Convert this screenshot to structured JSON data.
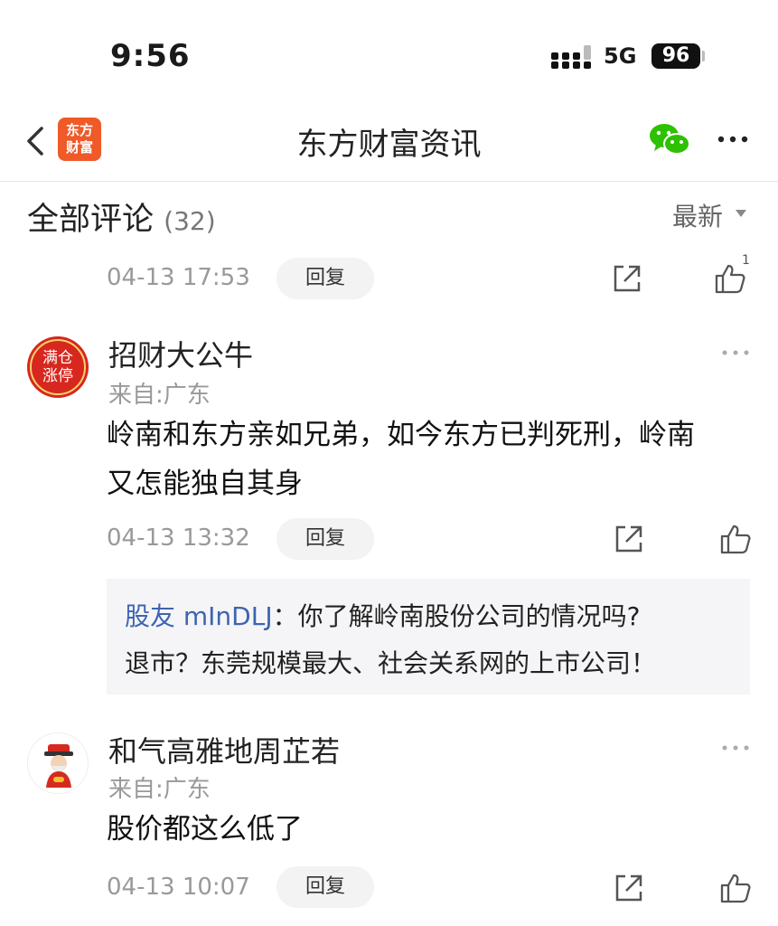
{
  "status_bar": {
    "time": "9:56",
    "network": "5G",
    "battery": "96"
  },
  "nav": {
    "logo_text": "东方财富",
    "title": "东方财富资讯"
  },
  "comments_header": {
    "title": "全部评论",
    "count": "(32)",
    "sort_label": "最新"
  },
  "comments": [
    {
      "time": "04-13 17:53",
      "reply_label": "回复",
      "like_count": "1"
    },
    {
      "username": "招财大公牛",
      "source": "来自:广东",
      "body_line1": "岭南和东方亲如兄弟，如今东方已判死刑，岭南",
      "body_line2": "又怎能独自其身",
      "time": "04-13 13:32",
      "reply_label": "回复",
      "avatar_text": "满仓涨停",
      "quote": {
        "user": "股友 mInDLJ",
        "separator": "：",
        "line1": "你了解岭南股份公司的情况吗?",
        "line2": "退市？东莞规模最大、社会关系网的上市公司！"
      }
    },
    {
      "username": "和气高雅地周芷若",
      "source": "来自:广东",
      "body": "股价都这么低了",
      "time": "04-13 10:07",
      "reply_label": "回复"
    }
  ],
  "colors": {
    "brand": "#ef5a28",
    "link": "#3e64b0",
    "wechat": "#2dc100"
  }
}
